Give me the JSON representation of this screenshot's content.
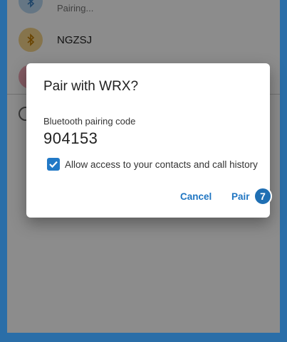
{
  "device_list": {
    "items": [
      {
        "label": "Pairing...",
        "icon": "bluetooth-icon"
      },
      {
        "label": "NGZSJ",
        "icon": "bluetooth-icon"
      },
      {
        "label": "",
        "icon": "device-icon"
      }
    ]
  },
  "dialog": {
    "title": "Pair with WRX?",
    "code_label": "Bluetooth pairing code",
    "code_value": "904153",
    "checkbox_label": "Allow access to your contacts and call history",
    "checkbox_checked": true,
    "cancel_label": "Cancel",
    "pair_label": "Pair"
  },
  "annotation": {
    "step_number": "7"
  },
  "colors": {
    "accent": "#1f75c2",
    "frame": "#2a6ea8"
  }
}
